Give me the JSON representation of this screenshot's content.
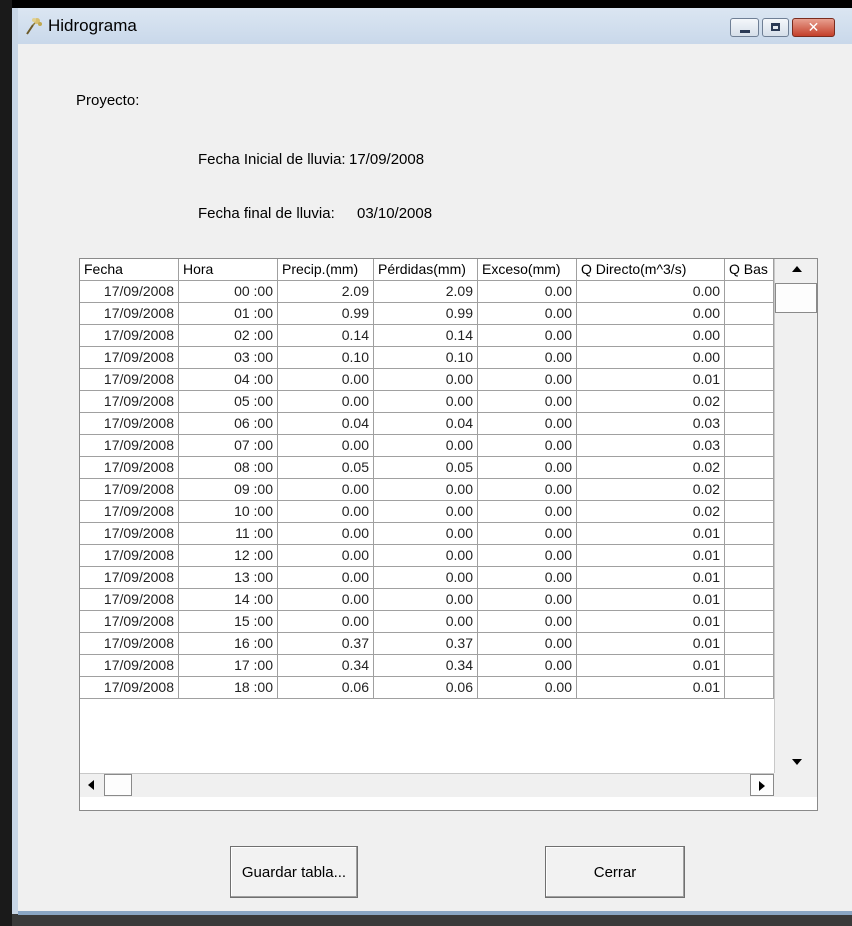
{
  "window": {
    "title": "Hidrograma",
    "close_glyph": "✕"
  },
  "form": {
    "proyecto_label": "Proyecto:",
    "fecha_inicial_label": "Fecha Inicial de lluvia:",
    "fecha_inicial_value": "17/09/2008",
    "fecha_final_label": "Fecha final de lluvia:",
    "fecha_final_value": "03/10/2008"
  },
  "table": {
    "headers": [
      "Fecha",
      "Hora",
      "Precip.(mm)",
      "Pérdidas(mm)",
      "Exceso(mm)",
      "Q Directo(m^3/s)",
      "Q Bas"
    ],
    "rows": [
      [
        "17/09/2008",
        "00 :00",
        "2.09",
        "2.09",
        "0.00",
        "0.00"
      ],
      [
        "17/09/2008",
        "01 :00",
        "0.99",
        "0.99",
        "0.00",
        "0.00"
      ],
      [
        "17/09/2008",
        "02 :00",
        "0.14",
        "0.14",
        "0.00",
        "0.00"
      ],
      [
        "17/09/2008",
        "03 :00",
        "0.10",
        "0.10",
        "0.00",
        "0.00"
      ],
      [
        "17/09/2008",
        "04 :00",
        "0.00",
        "0.00",
        "0.00",
        "0.01"
      ],
      [
        "17/09/2008",
        "05 :00",
        "0.00",
        "0.00",
        "0.00",
        "0.02"
      ],
      [
        "17/09/2008",
        "06 :00",
        "0.04",
        "0.04",
        "0.00",
        "0.03"
      ],
      [
        "17/09/2008",
        "07 :00",
        "0.00",
        "0.00",
        "0.00",
        "0.03"
      ],
      [
        "17/09/2008",
        "08 :00",
        "0.05",
        "0.05",
        "0.00",
        "0.02"
      ],
      [
        "17/09/2008",
        "09 :00",
        "0.00",
        "0.00",
        "0.00",
        "0.02"
      ],
      [
        "17/09/2008",
        "10 :00",
        "0.00",
        "0.00",
        "0.00",
        "0.02"
      ],
      [
        "17/09/2008",
        "11 :00",
        "0.00",
        "0.00",
        "0.00",
        "0.01"
      ],
      [
        "17/09/2008",
        "12 :00",
        "0.00",
        "0.00",
        "0.00",
        "0.01"
      ],
      [
        "17/09/2008",
        "13 :00",
        "0.00",
        "0.00",
        "0.00",
        "0.01"
      ],
      [
        "17/09/2008",
        "14 :00",
        "0.00",
        "0.00",
        "0.00",
        "0.01"
      ],
      [
        "17/09/2008",
        "15 :00",
        "0.00",
        "0.00",
        "0.00",
        "0.01"
      ],
      [
        "17/09/2008",
        "16 :00",
        "0.37",
        "0.37",
        "0.00",
        "0.01"
      ],
      [
        "17/09/2008",
        "17 :00",
        "0.34",
        "0.34",
        "0.00",
        "0.01"
      ],
      [
        "17/09/2008",
        "18 :00",
        "0.06",
        "0.06",
        "0.00",
        "0.01"
      ]
    ]
  },
  "buttons": {
    "guardar": "Guardar tabla...",
    "cerrar": "Cerrar"
  }
}
